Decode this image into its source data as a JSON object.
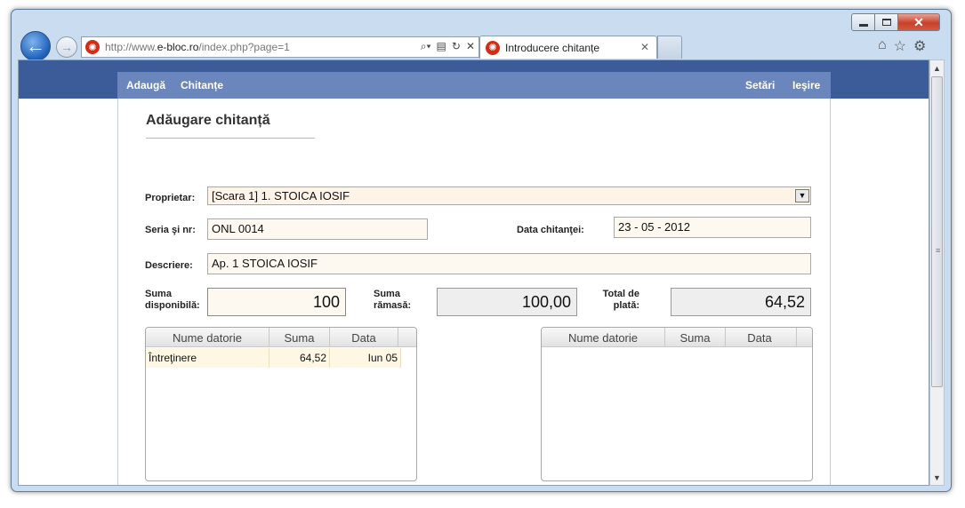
{
  "browser": {
    "url_prefix": "http://www.",
    "url_host": "e-bloc.ro",
    "url_path": "/index.php?page=1",
    "tab_title": "Introducere chitanțe",
    "close_glyph": "✕",
    "min_glyph": "",
    "icons": [
      "back-arrow-icon",
      "forward-arrow-icon",
      "search-icon",
      "refresh-icon",
      "stop-icon",
      "home-icon",
      "favorites-star-icon",
      "gear-icon"
    ]
  },
  "menu": {
    "left": [
      "Adaugă",
      "Chitanțe"
    ],
    "right": [
      "Setări",
      "Ieşire"
    ]
  },
  "form": {
    "title": "Adăugare chitanță",
    "proprietar_label": "Proprietar:",
    "proprietar_value": "[Scara 1] 1. STOICA IOSIF",
    "seria_label": "Seria şi nr:",
    "seria_value": "ONL 0014",
    "data_label": "Data chitanţei:",
    "data_value": "23 - 05 - 2012",
    "descriere_label": "Descriere:",
    "descriere_value": "Ap. 1 STOICA IOSIF",
    "suma_disp_label_1": "Suma",
    "suma_disp_label_2": "disponibilă:",
    "suma_disp_value": "100",
    "suma_ramasa_label_1": "Suma",
    "suma_ramasa_label_2": "rămasă:",
    "suma_ramasa_value": "100,00",
    "total_label_1": "Total de",
    "total_label_2": "plată:",
    "total_value": "64,52"
  },
  "left_table": {
    "columns": [
      "Nume datorie",
      "Suma",
      "Data"
    ],
    "rows": [
      {
        "nume": "Întreţinere",
        "suma": "64,52",
        "data": "Iun 05"
      }
    ]
  },
  "right_table": {
    "columns": [
      "Nume datorie",
      "Suma",
      "Data"
    ],
    "rows": []
  },
  "colors": {
    "top_band": "#3b5c98",
    "menu_bar": "#6a86bd",
    "field_bg": "#fdf9f0",
    "readonly_bg": "#eeeeee",
    "row_highlight": "#fdf7e3"
  }
}
